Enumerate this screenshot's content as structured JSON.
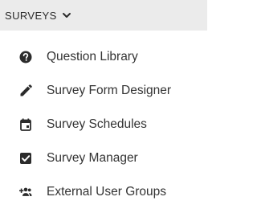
{
  "menu": {
    "header_label": "SURVEYS",
    "header_icon": "chevron-down-icon",
    "items": [
      {
        "label": "Question Library",
        "icon": "help-circle-icon"
      },
      {
        "label": "Survey Form Designer",
        "icon": "pencil-icon"
      },
      {
        "label": "Survey Schedules",
        "icon": "calendar-icon"
      },
      {
        "label": "Survey Manager",
        "icon": "checkbox-icon"
      },
      {
        "label": "External User Groups",
        "icon": "group-add-icon"
      }
    ]
  },
  "colors": {
    "header_background": "#ebebeb",
    "icon": "#2b2b2b",
    "text": "#333333"
  }
}
